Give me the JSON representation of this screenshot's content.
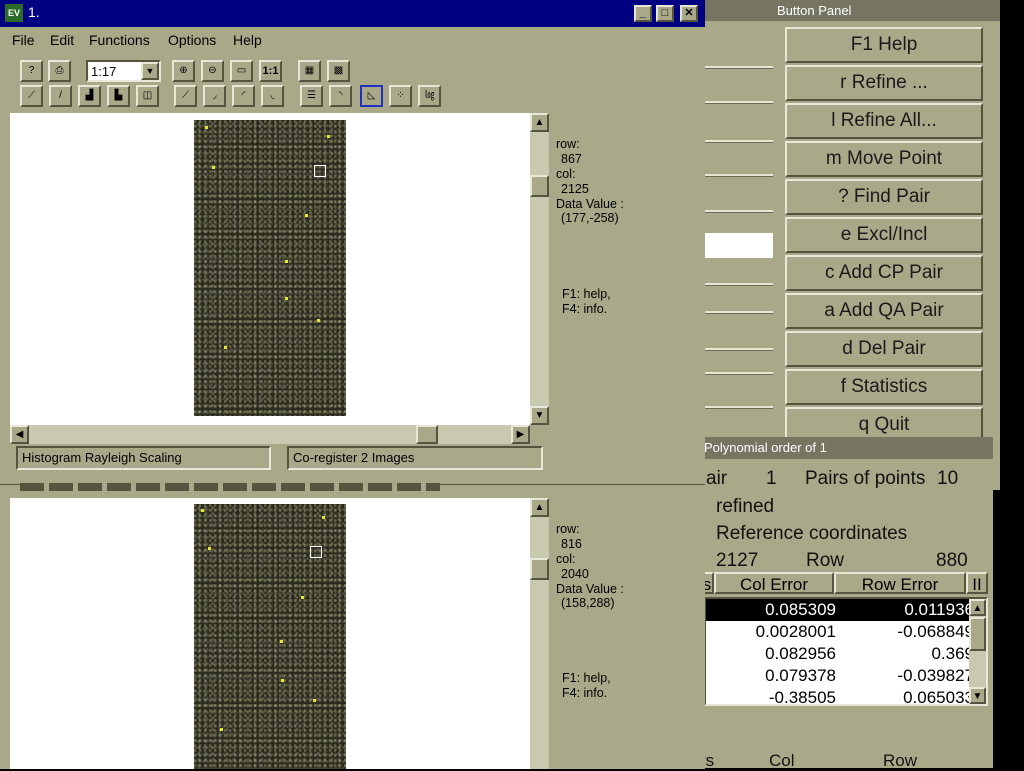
{
  "button_panel": {
    "title": "Button Panel",
    "buttons": [
      "F1 Help",
      "r Refine ...",
      "l Refine All...",
      "m Move Point",
      "? Find Pair",
      "e Excl/Incl",
      "c Add CP Pair",
      "a Add QA Pair",
      "d Del Pair",
      "f Statistics",
      "q Quit"
    ]
  },
  "stats": {
    "title": "Polynomial order of 1",
    "pair_label": "air",
    "pair_value": "1",
    "pairs_label": "Pairs of points",
    "pairs_value": "10",
    "refined": "refined",
    "ref_coords": "Reference coordinates",
    "col_value": "2127",
    "row_label": "Row",
    "row_value": "880",
    "header_s": "s",
    "header_col_error": "Col Error",
    "header_row_error": "Row Error",
    "header_ii": "II",
    "rows": [
      {
        "col_error": "0.085309",
        "row_error": "0.011936"
      },
      {
        "col_error": "0.0028001",
        "row_error": "-0.068849"
      },
      {
        "col_error": "0.082956",
        "row_error": "0.369"
      },
      {
        "col_error": "0.079378",
        "row_error": "-0.039827"
      },
      {
        "col_error": "-0.38505",
        "row_error": "0.065033"
      }
    ],
    "footer_rs": "rs",
    "footer_col": "Col",
    "footer_row": "Row"
  },
  "main_window": {
    "app_icon_text": "EV",
    "title": "1.",
    "menu": [
      "File",
      "Edit",
      "Functions",
      "Options",
      "Help"
    ],
    "zoom": "1:17",
    "zoom_reset": "1:1",
    "status_left": "Histogram Rayleigh Scaling",
    "status_right": "Co-register 2 Images"
  },
  "viewer_top": {
    "row_label": "row:",
    "row": "867",
    "col_label": "col:",
    "col": "2125",
    "dv_label": "Data Value :",
    "dv": "(177,-258)",
    "help1": "F1: help,",
    "help2": "F4: info."
  },
  "viewer_bottom": {
    "row_label": "row:",
    "row": "816",
    "col_label": "col:",
    "col": "2040",
    "dv_label": "Data Value :",
    "dv": "(158,288)",
    "help1": "F1: help,",
    "help2": "F4: info."
  }
}
